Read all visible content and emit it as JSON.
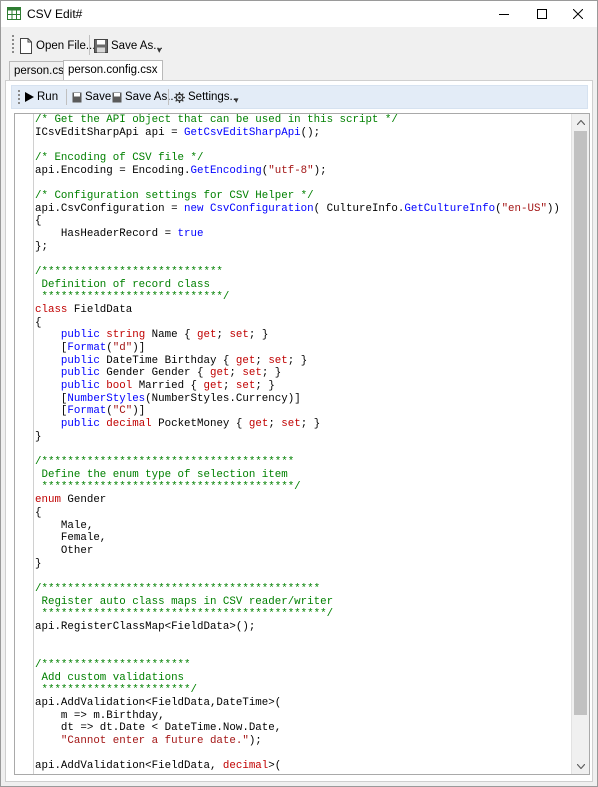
{
  "window": {
    "title": "CSV Edit#",
    "app_icon": "spreadsheet-icon",
    "controls": [
      "minimize-icon",
      "maximize-icon",
      "close-icon"
    ]
  },
  "toolbar": {
    "open_label": "Open File...",
    "save_as_label": "Save As..."
  },
  "tabs": [
    {
      "label": "person.csv",
      "active": false
    },
    {
      "label": "person.config.csx",
      "active": true
    }
  ],
  "script_toolbar": {
    "run_label": "Run",
    "save_label": "Save",
    "save_as_label": "Save As..",
    "settings_label": "Settings.."
  },
  "colors": {
    "comment": "#008000",
    "keyword": "#0000ff",
    "string": "#a31515",
    "type": "#c00000",
    "toolbar_bg": "#e3ecf7"
  },
  "code_lines": [
    [
      [
        "comment",
        "/* Get the API object that can be used in this script */"
      ]
    ],
    [
      [
        "plain",
        "ICsvEditSharpApi api = "
      ],
      [
        "method",
        "GetCsvEditSharpApi"
      ],
      [
        "plain",
        "();"
      ]
    ],
    [],
    [
      [
        "comment",
        "/* Encoding of CSV file */"
      ]
    ],
    [
      [
        "plain",
        "api.Encoding = Encoding."
      ],
      [
        "method",
        "GetEncoding"
      ],
      [
        "plain",
        "("
      ],
      [
        "string",
        "\"utf-8\""
      ],
      [
        "plain",
        ");"
      ]
    ],
    [],
    [
      [
        "comment",
        "/* Configuration settings for CSV Helper */"
      ]
    ],
    [
      [
        "plain",
        "api.CsvConfiguration = "
      ],
      [
        "keyword",
        "new"
      ],
      [
        "plain",
        " "
      ],
      [
        "method",
        "CsvConfiguration"
      ],
      [
        "plain",
        "( CultureInfo."
      ],
      [
        "method",
        "GetCultureInfo"
      ],
      [
        "plain",
        "("
      ],
      [
        "string",
        "\"en-US\""
      ],
      [
        "plain",
        "))"
      ]
    ],
    [
      [
        "plain",
        "{"
      ]
    ],
    [
      [
        "plain",
        "    HasHeaderRecord = "
      ],
      [
        "keyword",
        "true"
      ]
    ],
    [
      [
        "plain",
        "};"
      ]
    ],
    [],
    [
      [
        "comment",
        "/****************************"
      ]
    ],
    [
      [
        "comment",
        " Definition of record class"
      ]
    ],
    [
      [
        "comment",
        " ****************************/"
      ]
    ],
    [
      [
        "type",
        "class"
      ],
      [
        "plain",
        " FieldData"
      ]
    ],
    [
      [
        "plain",
        "{"
      ]
    ],
    [
      [
        "plain",
        "    "
      ],
      [
        "keyword",
        "public"
      ],
      [
        "plain",
        " "
      ],
      [
        "type",
        "string"
      ],
      [
        "plain",
        " Name { "
      ],
      [
        "type",
        "get"
      ],
      [
        "plain",
        "; "
      ],
      [
        "type",
        "set"
      ],
      [
        "plain",
        "; }"
      ]
    ],
    [
      [
        "plain",
        "    ["
      ],
      [
        "method",
        "Format"
      ],
      [
        "plain",
        "("
      ],
      [
        "string",
        "\"d\""
      ],
      [
        "plain",
        ")]"
      ]
    ],
    [
      [
        "plain",
        "    "
      ],
      [
        "keyword",
        "public"
      ],
      [
        "plain",
        " DateTime Birthday { "
      ],
      [
        "type",
        "get"
      ],
      [
        "plain",
        "; "
      ],
      [
        "type",
        "set"
      ],
      [
        "plain",
        "; }"
      ]
    ],
    [
      [
        "plain",
        "    "
      ],
      [
        "keyword",
        "public"
      ],
      [
        "plain",
        " Gender Gender { "
      ],
      [
        "type",
        "get"
      ],
      [
        "plain",
        "; "
      ],
      [
        "type",
        "set"
      ],
      [
        "plain",
        "; }"
      ]
    ],
    [
      [
        "plain",
        "    "
      ],
      [
        "keyword",
        "public"
      ],
      [
        "plain",
        " "
      ],
      [
        "type",
        "bool"
      ],
      [
        "plain",
        " Married { "
      ],
      [
        "type",
        "get"
      ],
      [
        "plain",
        "; "
      ],
      [
        "type",
        "set"
      ],
      [
        "plain",
        "; }"
      ]
    ],
    [
      [
        "plain",
        "    ["
      ],
      [
        "method",
        "NumberStyles"
      ],
      [
        "plain",
        "(NumberStyles.Currency)]"
      ]
    ],
    [
      [
        "plain",
        "    ["
      ],
      [
        "method",
        "Format"
      ],
      [
        "plain",
        "("
      ],
      [
        "string",
        "\"C\""
      ],
      [
        "plain",
        ")]"
      ]
    ],
    [
      [
        "plain",
        "    "
      ],
      [
        "keyword",
        "public"
      ],
      [
        "plain",
        " "
      ],
      [
        "type",
        "decimal"
      ],
      [
        "plain",
        " PocketMoney { "
      ],
      [
        "type",
        "get"
      ],
      [
        "plain",
        "; "
      ],
      [
        "type",
        "set"
      ],
      [
        "plain",
        "; }"
      ]
    ],
    [
      [
        "plain",
        "}"
      ]
    ],
    [],
    [
      [
        "comment",
        "/***************************************"
      ]
    ],
    [
      [
        "comment",
        " Define the enum type of selection item"
      ]
    ],
    [
      [
        "comment",
        " ***************************************/"
      ]
    ],
    [
      [
        "type",
        "enum"
      ],
      [
        "plain",
        " Gender"
      ]
    ],
    [
      [
        "plain",
        "{"
      ]
    ],
    [
      [
        "plain",
        "    Male,"
      ]
    ],
    [
      [
        "plain",
        "    Female,"
      ]
    ],
    [
      [
        "plain",
        "    Other"
      ]
    ],
    [
      [
        "plain",
        "}"
      ]
    ],
    [],
    [
      [
        "comment",
        "/*******************************************"
      ]
    ],
    [
      [
        "comment",
        " Register auto class maps in CSV reader/writer"
      ]
    ],
    [
      [
        "comment",
        " ********************************************/"
      ]
    ],
    [
      [
        "plain",
        "api.RegisterClassMap<FieldData>();"
      ]
    ],
    [],
    [],
    [
      [
        "comment",
        "/***********************"
      ]
    ],
    [
      [
        "comment",
        " Add custom validations"
      ]
    ],
    [
      [
        "comment",
        " ***********************/"
      ]
    ],
    [
      [
        "plain",
        "api.AddValidation<FieldData,DateTime>("
      ]
    ],
    [
      [
        "plain",
        "    m => m.Birthday,"
      ]
    ],
    [
      [
        "plain",
        "    dt => dt.Date < DateTime.Now.Date,"
      ]
    ],
    [
      [
        "plain",
        "    "
      ],
      [
        "string",
        "\"Cannot enter a future date.\""
      ],
      [
        "plain",
        ");"
      ]
    ],
    [],
    [
      [
        "plain",
        "api.AddValidation<FieldData, "
      ],
      [
        "type",
        "decimal"
      ],
      [
        "plain",
        ">("
      ]
    ]
  ]
}
